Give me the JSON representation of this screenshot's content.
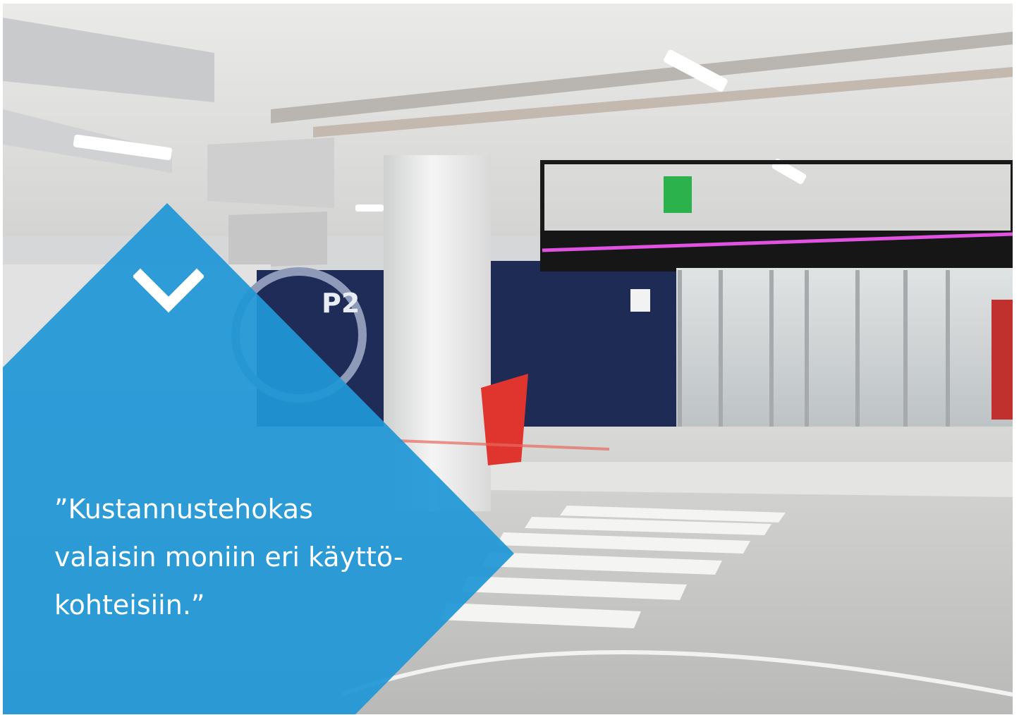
{
  "sign": {
    "text": "P2"
  },
  "quote": {
    "lines": [
      "”Kustannustehokas",
      "valaisin moniin eri käyttö-",
      "kohteisiin.”"
    ]
  },
  "colors": {
    "accent": "#1f97d6",
    "wall": "#1e2d55",
    "floor": "#cfd0cf",
    "ceiling": "#e6e6e4",
    "neon": "#e052e0",
    "bin": "#e0342f"
  },
  "icons": {
    "chevron": "chevron-down-icon"
  }
}
